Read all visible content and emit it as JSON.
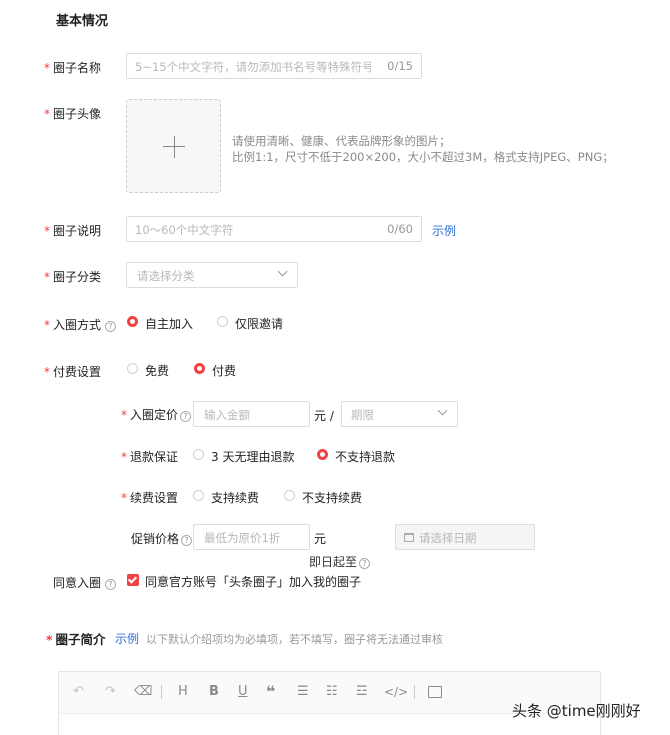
{
  "section_title": "基本情况",
  "name": {
    "label": "圈子名称",
    "placeholder": "5~15个中文字符，请勿添加书名号等特殊符号",
    "counter": "0/15"
  },
  "avatar": {
    "label": "圈子头像",
    "hint1": "请使用清晰、健康、代表品牌形象的图片；",
    "hint2": "比例1:1，尺寸不低于200×200，大小不超过3M，格式支持JPEG、PNG；"
  },
  "desc": {
    "label": "圈子说明",
    "placeholder": "10～60个中文字符",
    "counter": "0/60",
    "example": "示例"
  },
  "category": {
    "label": "圈子分类",
    "placeholder": "请选择分类"
  },
  "join": {
    "label": "入圈方式",
    "opt1": "自主加入",
    "opt2": "仅限邀请"
  },
  "fee": {
    "label": "付费设置",
    "opt1": "免费",
    "opt2": "付费"
  },
  "price": {
    "label": "入圈定价",
    "placeholder": "输入金额",
    "unit": "元 /",
    "period": "期限"
  },
  "refund": {
    "label": "退款保证",
    "opt1": "3 天无理由退款",
    "opt2": "不支持退款"
  },
  "renew": {
    "label": "续费设置",
    "opt1": "支持续费",
    "opt2": "不支持续费"
  },
  "promo": {
    "label": "促销价格",
    "placeholder": "最低为原价1折",
    "unit": "元",
    "date_placeholder": "请选择日期",
    "start": "即日起至"
  },
  "agree": {
    "label": "同意入圈",
    "text": "同意官方账号「头条圈子」加入我的圈子"
  },
  "intro": {
    "label": "圈子简介",
    "example": "示例",
    "note": "以下默认介绍项均为必填项，若不填写，圈子将无法通过审核"
  },
  "watermark": "头条 @time刚刚好",
  "colors": {
    "accent": "#f04142",
    "link": "#2b6fdc"
  }
}
